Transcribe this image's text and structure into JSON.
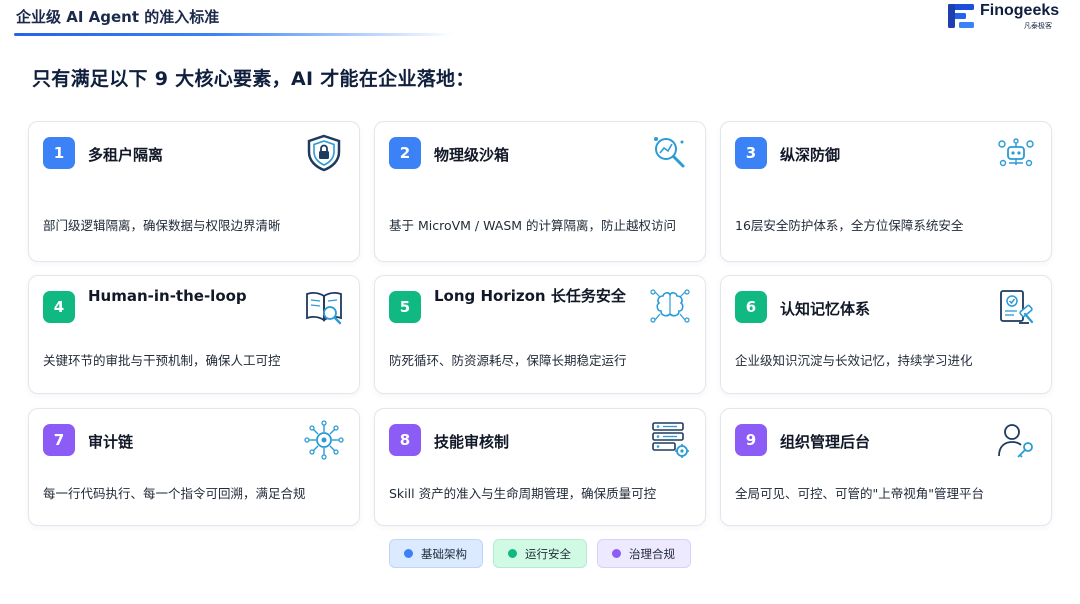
{
  "header": {
    "title": "企业级 AI Agent 的准入标准"
  },
  "logo": {
    "name": "Finogeeks",
    "sub": "凡泰极客"
  },
  "subtitle": "只有满足以下 9 大核心要素，AI 才能在企业落地：",
  "colors": {
    "blue": "#3b82f6",
    "green": "#10b981",
    "purple": "#8b5cf6",
    "icon_stroke": "#2a9bd7",
    "icon_dark": "#1e3a5f"
  },
  "cards": [
    {
      "num": "1",
      "title": "多租户隔离",
      "desc": "部门级逻辑隔离，确保数据与权限边界清晰",
      "category": "blue",
      "icon": "shield-lock-icon"
    },
    {
      "num": "2",
      "title": "物理级沙箱",
      "desc": "基于 MicroVM / WASM 的计算隔离，防止越权访问",
      "category": "blue",
      "icon": "magnifier-chart-icon"
    },
    {
      "num": "3",
      "title": "纵深防御",
      "desc": "16层安全防护体系，全方位保障系统安全",
      "category": "blue",
      "icon": "robot-network-icon"
    },
    {
      "num": "4",
      "title": "Human-in-the-loop",
      "desc": "关键环节的审批与干预机制，确保人工可控",
      "category": "green",
      "icon": "book-search-icon"
    },
    {
      "num": "5",
      "title": "Long Horizon 长任务安全",
      "desc": "防死循环、防资源耗尽，保障长期稳定运行",
      "category": "green",
      "icon": "brain-circuit-icon"
    },
    {
      "num": "6",
      "title": "认知记忆体系",
      "desc": "企业级知识沉淀与长效记忆，持续学习进化",
      "category": "green",
      "icon": "document-gavel-icon"
    },
    {
      "num": "7",
      "title": "审计链",
      "desc": "每一行代码执行、每一个指令可回溯，满足合规",
      "category": "purple",
      "icon": "gear-network-icon"
    },
    {
      "num": "8",
      "title": "技能审核制",
      "desc": "Skill 资产的准入与生命周期管理，确保质量可控",
      "category": "purple",
      "icon": "server-gear-icon"
    },
    {
      "num": "9",
      "title": "组织管理后台",
      "desc": "全局可见、可控、可管的\"上帝视角\"管理平台",
      "category": "purple",
      "icon": "user-key-icon"
    }
  ],
  "legend": [
    {
      "label": "基础架构",
      "category": "blue"
    },
    {
      "label": "运行安全",
      "category": "green"
    },
    {
      "label": "治理合规",
      "category": "purple"
    }
  ]
}
